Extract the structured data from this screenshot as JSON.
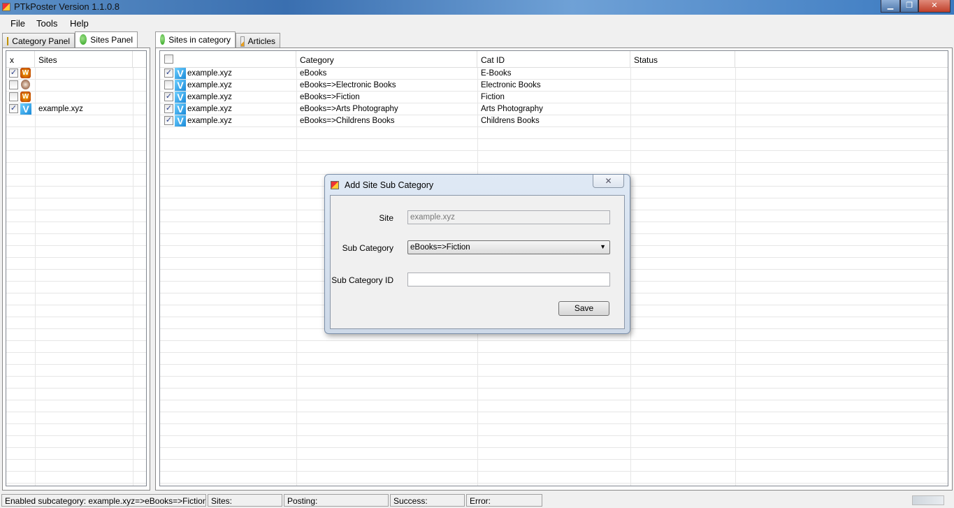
{
  "window": {
    "title": "PTkPoster Version 1.1.0.8",
    "controls": [
      "minimize",
      "restore",
      "close"
    ]
  },
  "menu": [
    "File",
    "Tools",
    "Help"
  ],
  "left_tabs": [
    {
      "label": "Category Panel",
      "icon": "folder-icon"
    },
    {
      "label": "Sites Panel",
      "icon": "globe-icon",
      "active": true
    }
  ],
  "right_tabs": [
    {
      "label": "Sites in category",
      "icon": "globe-icon",
      "active": true
    },
    {
      "label": "Articles",
      "icon": "pencil-icon"
    }
  ],
  "sites_grid": {
    "headers": [
      "x",
      "Sites"
    ],
    "rows": [
      {
        "checked": true,
        "icon": "wordpress-icon",
        "site": ""
      },
      {
        "checked": false,
        "icon": "blogger-icon",
        "site": ""
      },
      {
        "checked": false,
        "icon": "wordpress-icon",
        "site": ""
      },
      {
        "checked": true,
        "icon": "v-logo-icon",
        "site": "example.xyz"
      }
    ]
  },
  "category_grid": {
    "headers": [
      "",
      "Category",
      "Cat ID",
      "Status"
    ],
    "rows": [
      {
        "checked": true,
        "site": "example.xyz",
        "category": "eBooks",
        "cat_id": "E-Books",
        "status": ""
      },
      {
        "checked": false,
        "site": "example.xyz",
        "category": "eBooks=>Electronic Books",
        "cat_id": "Electronic Books",
        "status": ""
      },
      {
        "checked": true,
        "site": "example.xyz",
        "category": "eBooks=>Fiction",
        "cat_id": "Fiction",
        "status": ""
      },
      {
        "checked": true,
        "site": "example.xyz",
        "category": "eBooks=>Arts Photography",
        "cat_id": "Arts Photography",
        "status": ""
      },
      {
        "checked": true,
        "site": "example.xyz",
        "category": "eBooks=>Childrens Books",
        "cat_id": "Childrens Books",
        "status": ""
      }
    ]
  },
  "dialog": {
    "title": "Add Site Sub Category",
    "site_label": "Site",
    "site_value": "example.xyz",
    "subcat_label": "Sub Category",
    "subcat_value": "eBooks=>Fiction",
    "subcat_id_label": "Sub Category ID",
    "subcat_id_value": "",
    "save": "Save",
    "close": "✕"
  },
  "statusbar": {
    "message": "Enabled subcategory: example.xyz=>eBooks=>Fiction",
    "sites": "Sites:",
    "posting": "Posting:",
    "success": "Success:",
    "error": "Error:"
  }
}
